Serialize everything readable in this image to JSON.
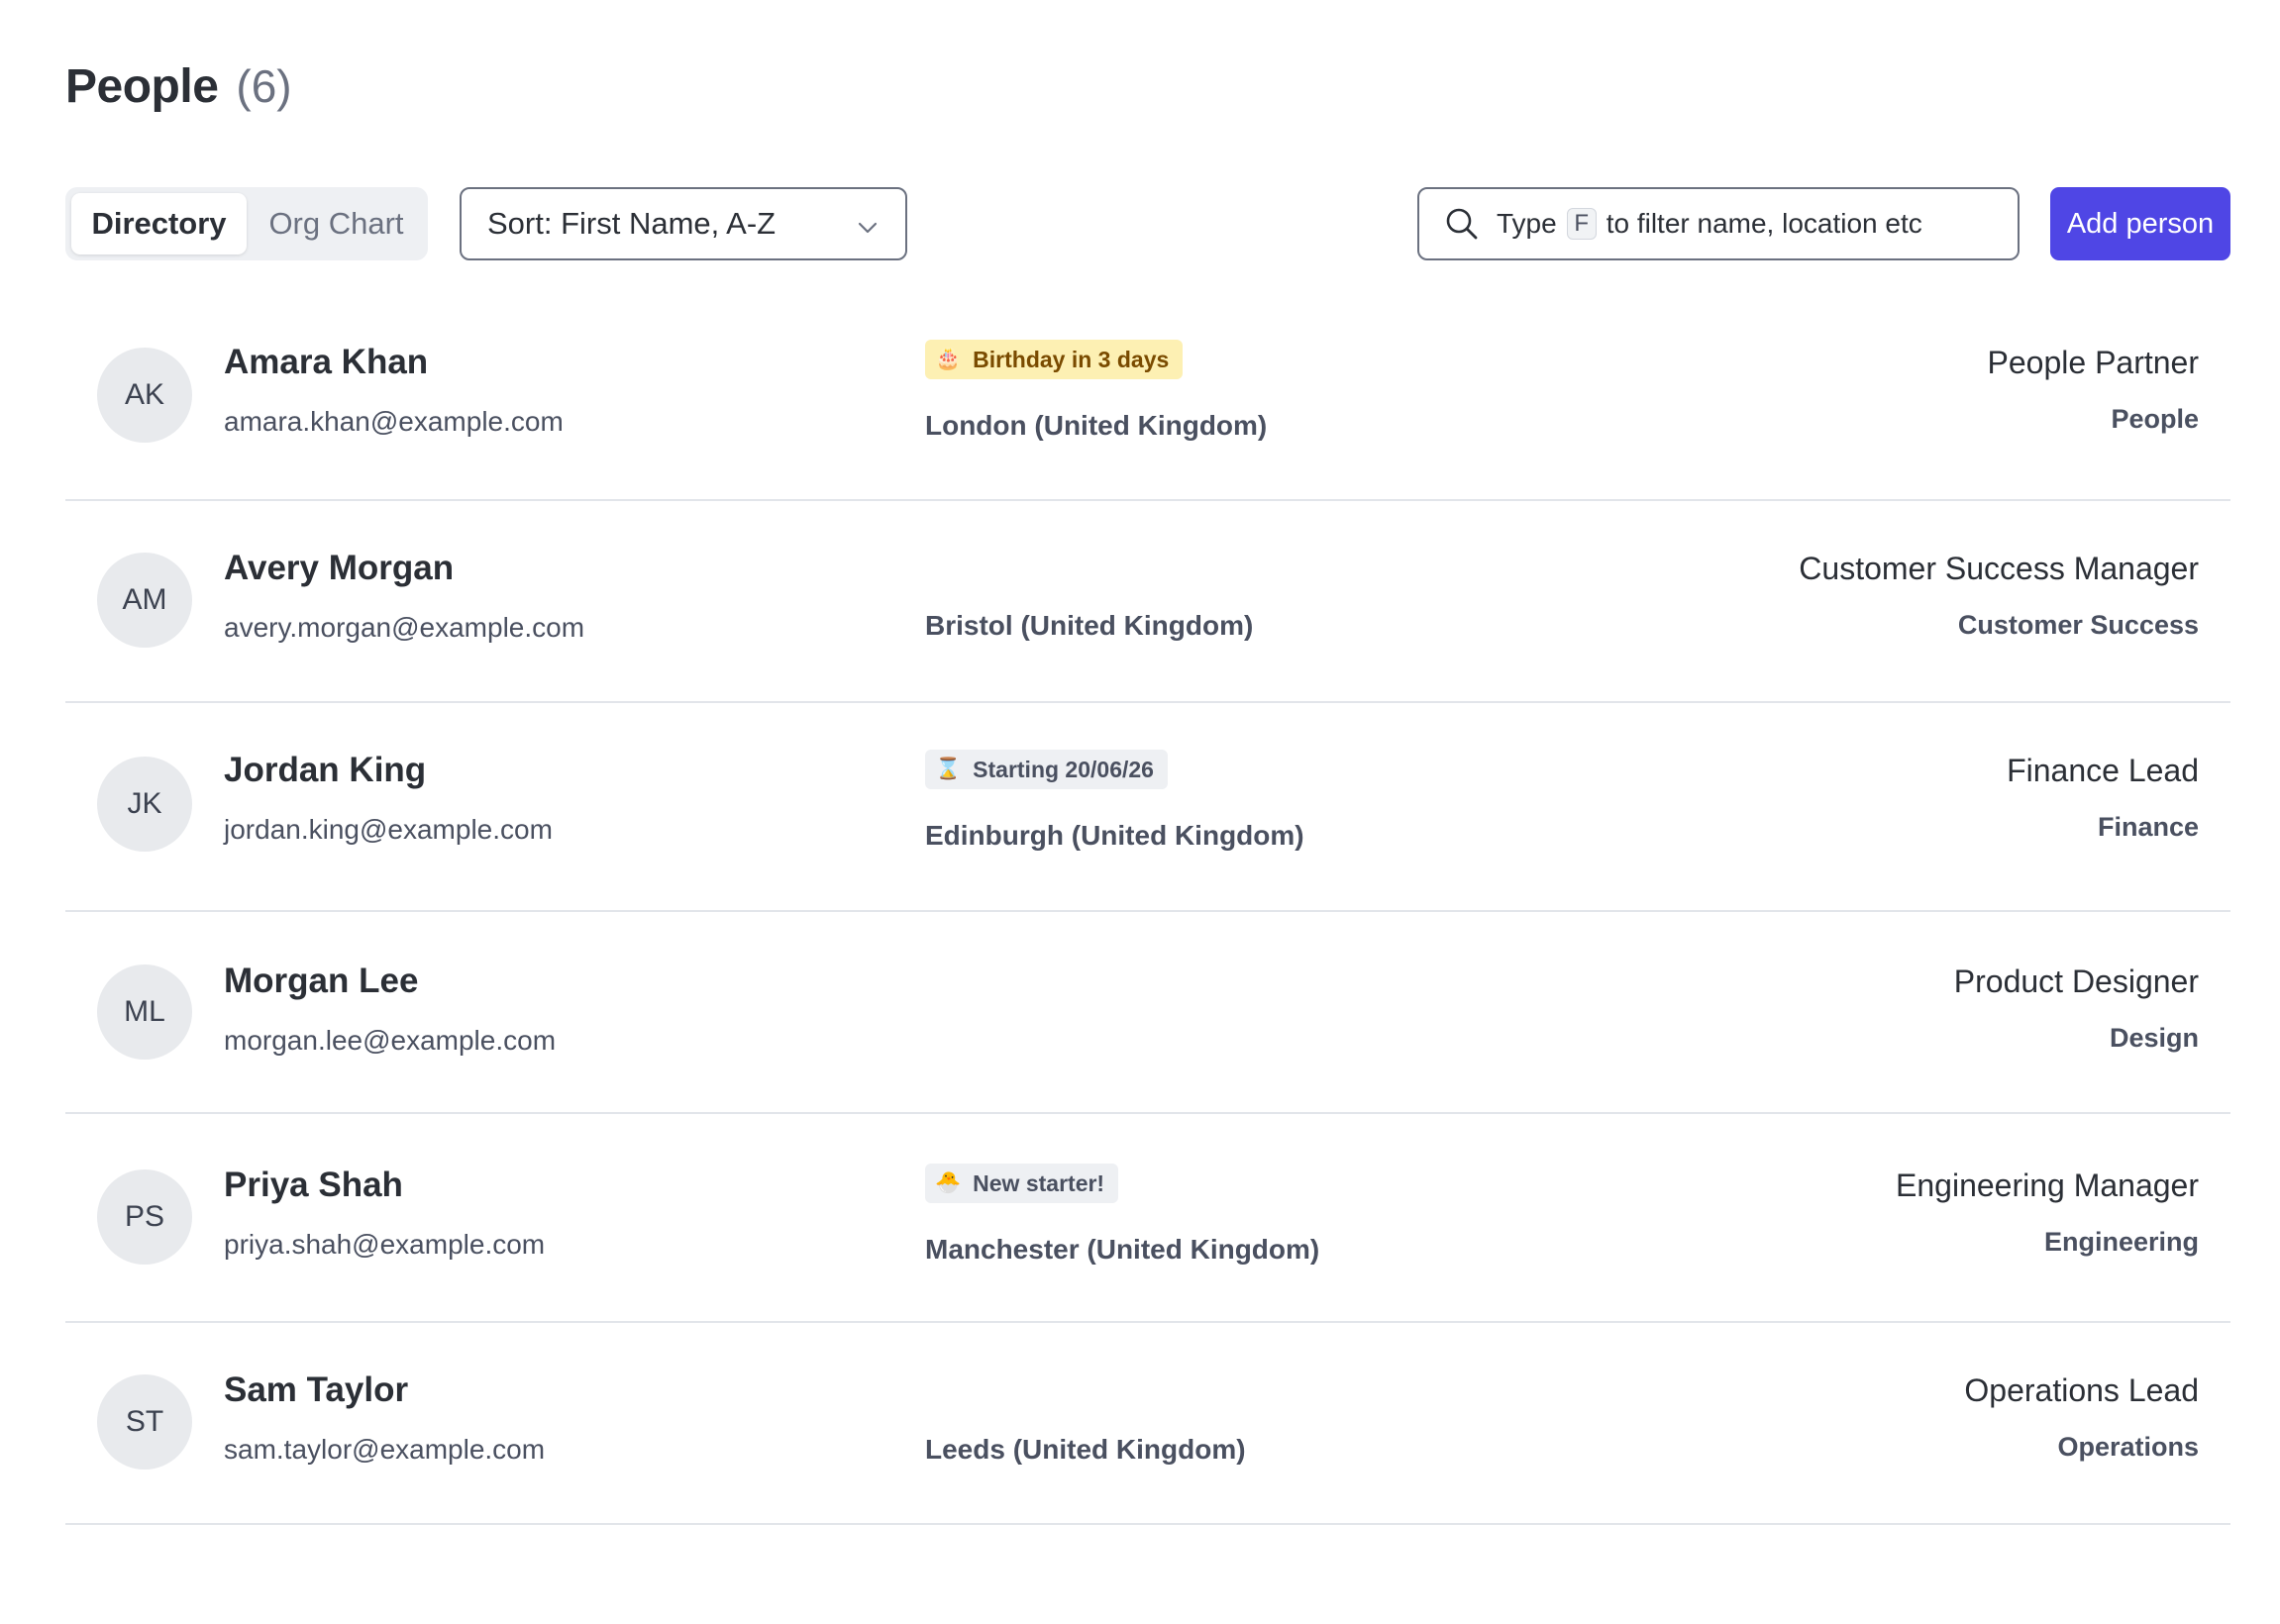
{
  "header": {
    "title": "People",
    "count": "(6)"
  },
  "view_toggle": {
    "directory_label": "Directory",
    "org_chart_label": "Org Chart",
    "selected": "Directory"
  },
  "sort": {
    "label": "Sort: First Name, A-Z"
  },
  "search": {
    "prefix": "Type",
    "shortcut_key": "F",
    "suffix": "to filter name, location etc"
  },
  "actions": {
    "add_person_label": "Add person"
  },
  "colors": {
    "primary": "#4f46e5",
    "birthday_badge_bg": "#fdf0b3",
    "birthday_badge_text": "#7a4b00",
    "neutral_badge_bg": "#eef0f3"
  },
  "people": [
    {
      "initials": "AK",
      "name": "Amara Khan",
      "email": "amara.khan@example.com",
      "badge": {
        "icon": "birthday-cake-icon",
        "glyph": "🎂",
        "text": "Birthday in 3 days",
        "style": "birthday"
      },
      "location": "London (United Kingdom)",
      "role": "People Partner",
      "department": "People"
    },
    {
      "initials": "AM",
      "name": "Avery Morgan",
      "email": "avery.morgan@example.com",
      "badge": null,
      "location": "Bristol (United Kingdom)",
      "role": "Customer Success Manager",
      "department": "Customer Success"
    },
    {
      "initials": "JK",
      "name": "Jordan King",
      "email": "jordan.king@example.com",
      "badge": {
        "icon": "hourglass-icon",
        "glyph": "⌛",
        "text": "Starting 20/06/26",
        "style": "neutral"
      },
      "location": "Edinburgh (United Kingdom)",
      "role": "Finance Lead",
      "department": "Finance"
    },
    {
      "initials": "ML",
      "name": "Morgan Lee",
      "email": "morgan.lee@example.com",
      "badge": null,
      "location": "",
      "role": "Product Designer",
      "department": "Design"
    },
    {
      "initials": "PS",
      "name": "Priya Shah",
      "email": "priya.shah@example.com",
      "badge": {
        "icon": "hatching-chick-icon",
        "glyph": "🐣",
        "text": "New starter!",
        "style": "neutral"
      },
      "location": "Manchester (United Kingdom)",
      "role": "Engineering Manager",
      "department": "Engineering"
    },
    {
      "initials": "ST",
      "name": "Sam Taylor",
      "email": "sam.taylor@example.com",
      "badge": null,
      "location": "Leeds (United Kingdom)",
      "role": "Operations Lead",
      "department": "Operations"
    }
  ]
}
